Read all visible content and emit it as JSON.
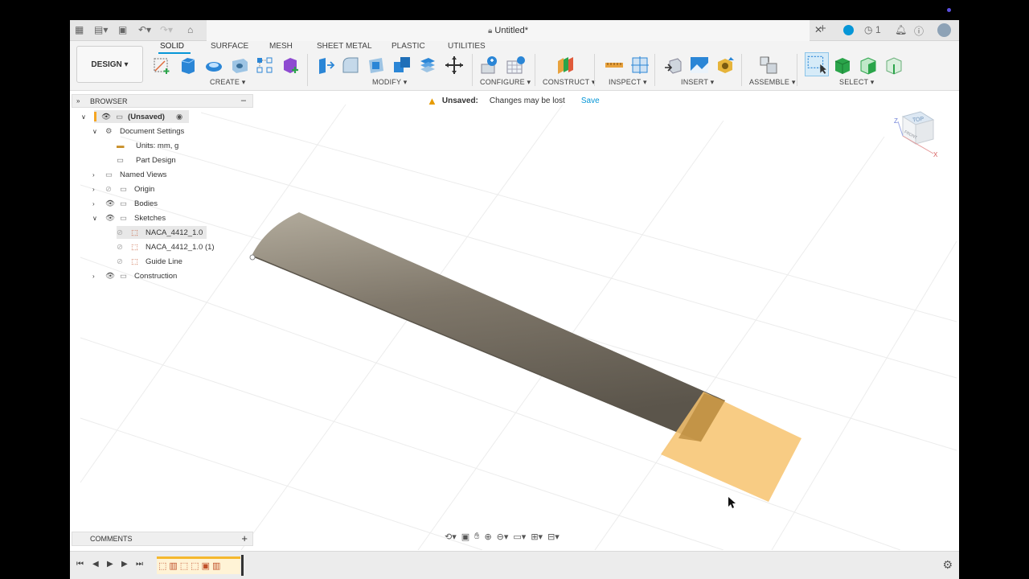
{
  "title_bar": {
    "doc_title": "Untitled*",
    "jobs_count": "1"
  },
  "workspace": {
    "design_label": "DESIGN",
    "tabs": [
      "SOLID",
      "SURFACE",
      "MESH",
      "SHEET METAL",
      "PLASTIC",
      "UTILITIES"
    ],
    "groups": [
      "CREATE",
      "MODIFY",
      "CONFIGURE",
      "CONSTRUCT",
      "INSPECT",
      "INSERT",
      "ASSEMBLE",
      "SELECT"
    ]
  },
  "notice": {
    "label": "Unsaved:",
    "message": "Changes may be lost",
    "action": "Save"
  },
  "browser": {
    "header": "BROWSER",
    "root": "(Unsaved)",
    "items": [
      {
        "label": "Document Settings"
      },
      {
        "label": "Units: mm, g"
      },
      {
        "label": "Part Design"
      },
      {
        "label": "Named Views"
      },
      {
        "label": "Origin"
      },
      {
        "label": "Bodies"
      },
      {
        "label": "Sketches"
      },
      {
        "label": "NACA_4412_1.0"
      },
      {
        "label": "NACA_4412_1.0 (1)"
      },
      {
        "label": "Guide Line"
      },
      {
        "label": "Construction"
      }
    ]
  },
  "viewcube": {
    "top": "TOP",
    "front": "FRONT",
    "axis_z": "Z",
    "axis_x": "X"
  },
  "comments": {
    "label": "COMMENTS"
  },
  "colors": {
    "accent": "#0696d7",
    "plane": "#f7c36f",
    "body": "#8a8272"
  }
}
